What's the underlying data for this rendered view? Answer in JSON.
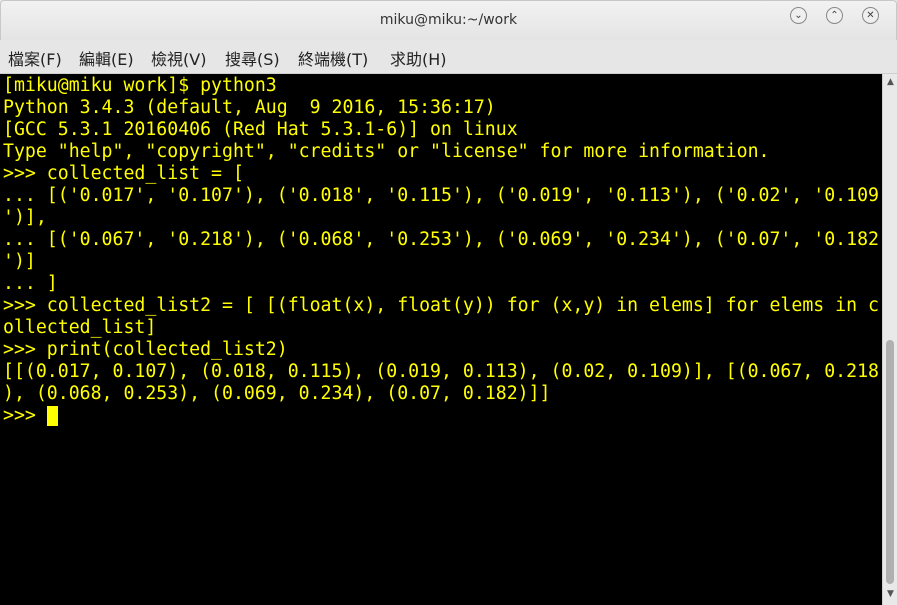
{
  "window": {
    "title": "miku@miku:~/work",
    "buttons": {
      "minimize_icon": "chevron-down",
      "maximize_icon": "chevron-up",
      "close_icon": "close"
    }
  },
  "menu": {
    "items": [
      {
        "label": "檔案(F)"
      },
      {
        "label": "編輯(E)"
      },
      {
        "label": "檢視(V)"
      },
      {
        "label": "搜尋(S)"
      },
      {
        "label": "終端機(T)"
      },
      {
        "label": "求助(H)"
      }
    ]
  },
  "terminal": {
    "text_color": "#ffff00",
    "background_color": "#000000",
    "lines": [
      "[miku@miku work]$ python3",
      "Python 3.4.3 (default, Aug  9 2016, 15:36:17)",
      "[GCC 5.3.1 20160406 (Red Hat 5.3.1-6)] on linux",
      "Type \"help\", \"copyright\", \"credits\" or \"license\" for more information.",
      ">>> collected_list = [",
      "... [('0.017', '0.107'), ('0.018', '0.115'), ('0.019', '0.113'), ('0.02', '0.109",
      "')],",
      "... [('0.067', '0.218'), ('0.068', '0.253'), ('0.069', '0.234'), ('0.07', '0.182",
      "')]",
      "... ]",
      ">>> collected_list2 = [ [(float(x), float(y)) for (x,y) in elems] for elems in c",
      "ollected_list]",
      ">>> print(collected_list2)",
      "[[(0.017, 0.107), (0.018, 0.115), (0.019, 0.113), (0.02, 0.109)], [(0.067, 0.218",
      "), (0.068, 0.253), (0.069, 0.234), (0.07, 0.182)]]"
    ],
    "prompt": ">>> "
  }
}
